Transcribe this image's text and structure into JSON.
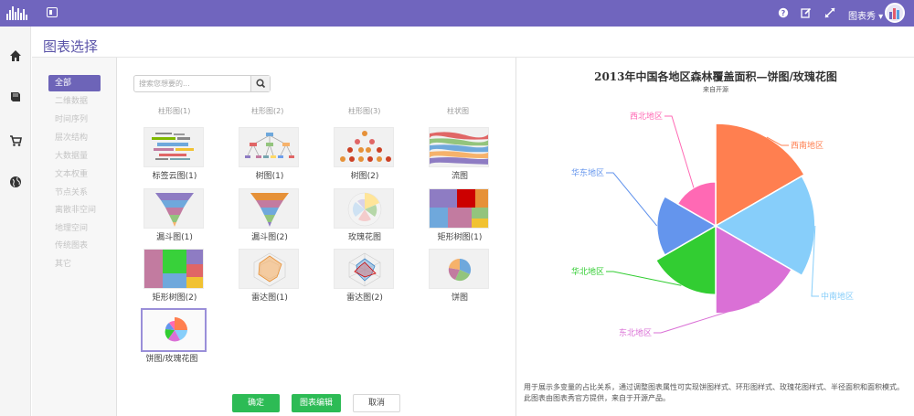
{
  "topbar": {
    "user_name": "图表秀 ▾",
    "icons": [
      "help-icon",
      "edit-icon",
      "expand-icon"
    ]
  },
  "sidebar_icons": [
    "home-icon",
    "book-icon",
    "cart-icon",
    "globe-icon"
  ],
  "page": {
    "title": "图表选择"
  },
  "categories": [
    {
      "label": "全部",
      "active": true
    },
    {
      "label": "二维数据",
      "active": false
    },
    {
      "label": "时间序列",
      "active": false
    },
    {
      "label": "层次结构",
      "active": false
    },
    {
      "label": "大数据量",
      "active": false
    },
    {
      "label": "文本权重",
      "active": false
    },
    {
      "label": "节点关系",
      "active": false
    },
    {
      "label": "离散非空间",
      "active": false
    },
    {
      "label": "地理空间",
      "active": false
    },
    {
      "label": "传统图表",
      "active": false
    },
    {
      "label": "其它",
      "active": false
    }
  ],
  "search": {
    "placeholder": "搜索您想要的..."
  },
  "gallery": {
    "cut_labels": [
      "柱形图(1)",
      "柱形图(2)",
      "柱形图(3)",
      "柱状图"
    ],
    "tiles": [
      {
        "label": "标签云图(1)"
      },
      {
        "label": "树图(1)"
      },
      {
        "label": "树图(2)"
      },
      {
        "label": "流图"
      },
      {
        "label": "漏斗图(1)"
      },
      {
        "label": "漏斗图(2)"
      },
      {
        "label": "玫瑰花图"
      },
      {
        "label": "矩形树图(1)"
      },
      {
        "label": "矩形树图(2)"
      },
      {
        "label": "雷达图(1)"
      },
      {
        "label": "雷达图(2)"
      },
      {
        "label": "饼图"
      },
      {
        "label": "饼图/玫瑰花图",
        "selected": true
      }
    ]
  },
  "buttons": {
    "confirm": "确定",
    "edit": "图表编辑",
    "cancel": "取消"
  },
  "preview": {
    "description": "用于展示多变量的占比关系，通过调整图表属性可实现饼图样式、环形图样式、玫瑰花图样式、半径面积和面积模式。此图表由图表秀官方提供，来自于开源产品。"
  },
  "chart_data": {
    "type": "pie",
    "title": "2013年中国各地区森林覆盖面积—饼图/玫瑰花图",
    "subtitle": "来自开源",
    "categories": [
      "西南地区",
      "中南地区",
      "东北地区",
      "华北地区",
      "华东地区",
      "西北地区"
    ],
    "values": [
      25,
      24,
      20,
      14,
      11,
      7
    ],
    "colors": [
      "#ff7f50",
      "#87cefa",
      "#da70d6",
      "#32cd32",
      "#6495ed",
      "#ff69b4"
    ],
    "legend": "labels-outside"
  }
}
